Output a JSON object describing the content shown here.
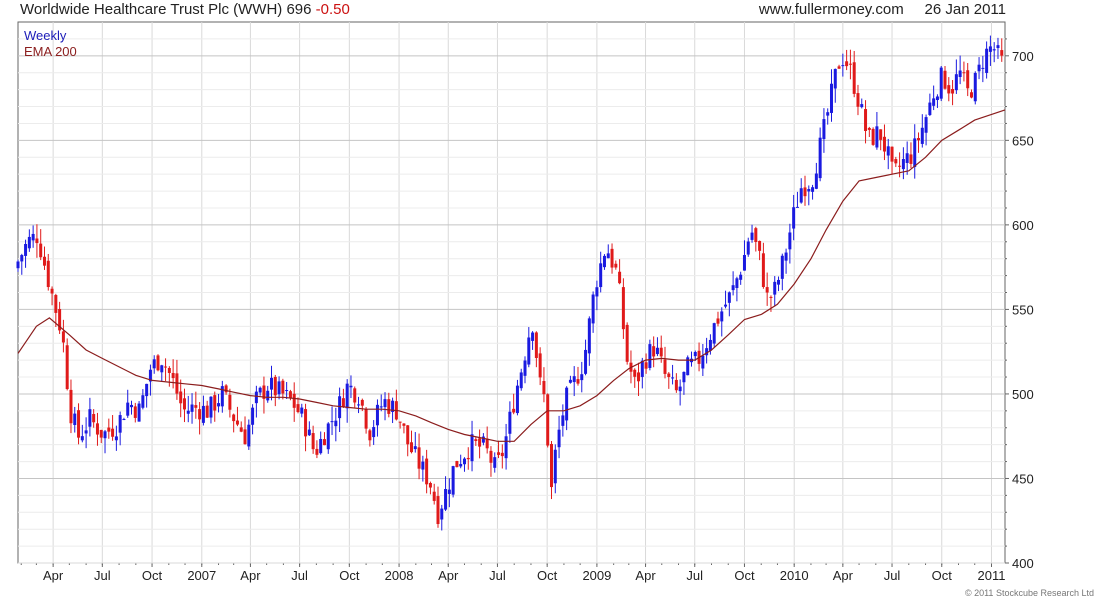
{
  "header": {
    "security": "Worldwide Healthcare Trust Plc (WWH)",
    "last_price": "696",
    "change": "-0.50",
    "site": "www.fullermoney.com",
    "date": "26 Jan 2011"
  },
  "legend": {
    "weekly": "Weekly",
    "ema": "EMA 200"
  },
  "copyright": "© 2011 Stockcube Research Ltd",
  "colors": {
    "up": "#1a1ae0",
    "down": "#e01a1a",
    "ema": "#8b1d1d",
    "grid": "#d9d9d9",
    "axis": "#666666",
    "background": "#ffffff"
  },
  "chart_data": {
    "type": "candlestick",
    "frequency": "weekly",
    "ylim": [
      400,
      720
    ],
    "yticks": [
      400,
      450,
      500,
      550,
      600,
      650,
      700
    ],
    "xlim": [
      "2006-01-26",
      "2011-01-26"
    ],
    "x_ticks": [
      {
        "label": "Apr",
        "date": "2006-04-01"
      },
      {
        "label": "Jul",
        "date": "2006-07-01"
      },
      {
        "label": "Oct",
        "date": "2006-10-01"
      },
      {
        "label": "2007",
        "date": "2007-01-01"
      },
      {
        "label": "Apr",
        "date": "2007-04-01"
      },
      {
        "label": "Jul",
        "date": "2007-07-01"
      },
      {
        "label": "Oct",
        "date": "2007-10-01"
      },
      {
        "label": "2008",
        "date": "2008-01-01"
      },
      {
        "label": "Apr",
        "date": "2008-04-01"
      },
      {
        "label": "Jul",
        "date": "2008-07-01"
      },
      {
        "label": "Oct",
        "date": "2008-10-01"
      },
      {
        "label": "2009",
        "date": "2009-01-01"
      },
      {
        "label": "Apr",
        "date": "2009-04-01"
      },
      {
        "label": "Jul",
        "date": "2009-07-01"
      },
      {
        "label": "Oct",
        "date": "2009-10-01"
      },
      {
        "label": "2010",
        "date": "2010-01-01"
      },
      {
        "label": "Apr",
        "date": "2010-04-01"
      },
      {
        "label": "Jul",
        "date": "2010-07-01"
      },
      {
        "label": "Oct",
        "date": "2010-10-01"
      },
      {
        "label": "2011",
        "date": "2011-01-01"
      }
    ],
    "grid": true,
    "legend_position": "top-left",
    "price_path": [
      [
        "2006-01-26",
        574
      ],
      [
        "2006-02-20",
        590
      ],
      [
        "2006-03-10",
        594
      ],
      [
        "2006-04-05",
        560
      ],
      [
        "2006-04-25",
        535
      ],
      [
        "2006-05-10",
        490
      ],
      [
        "2006-05-25",
        475
      ],
      [
        "2006-06-15",
        485
      ],
      [
        "2006-07-10",
        476
      ],
      [
        "2006-08-05",
        482
      ],
      [
        "2006-08-25",
        495
      ],
      [
        "2006-09-15",
        490
      ],
      [
        "2006-10-05",
        515
      ],
      [
        "2006-10-25",
        522
      ],
      [
        "2006-11-15",
        508
      ],
      [
        "2006-12-05",
        490
      ],
      [
        "2006-12-25",
        492
      ],
      [
        "2007-01-20",
        490
      ],
      [
        "2007-02-15",
        500
      ],
      [
        "2007-03-10",
        485
      ],
      [
        "2007-03-30",
        475
      ],
      [
        "2007-04-20",
        497
      ],
      [
        "2007-05-10",
        505
      ],
      [
        "2007-06-05",
        500
      ],
      [
        "2007-06-25",
        495
      ],
      [
        "2007-07-15",
        485
      ],
      [
        "2007-08-05",
        465
      ],
      [
        "2007-08-25",
        478
      ],
      [
        "2007-09-15",
        490
      ],
      [
        "2007-10-05",
        505
      ],
      [
        "2007-10-25",
        500
      ],
      [
        "2007-11-15",
        478
      ],
      [
        "2007-12-10",
        496
      ],
      [
        "2008-01-05",
        490
      ],
      [
        "2008-01-25",
        470
      ],
      [
        "2008-02-15",
        458
      ],
      [
        "2008-03-05",
        448
      ],
      [
        "2008-03-20",
        430
      ],
      [
        "2008-04-01",
        440
      ],
      [
        "2008-04-20",
        458
      ],
      [
        "2008-05-20",
        470
      ],
      [
        "2008-06-15",
        468
      ],
      [
        "2008-07-05",
        455
      ],
      [
        "2008-07-20",
        468
      ],
      [
        "2008-08-10",
        500
      ],
      [
        "2008-08-25",
        520
      ],
      [
        "2008-09-10",
        545
      ],
      [
        "2008-09-25",
        505
      ],
      [
        "2008-10-05",
        495
      ],
      [
        "2008-10-15",
        440
      ],
      [
        "2008-10-25",
        470
      ],
      [
        "2008-11-10",
        495
      ],
      [
        "2008-11-25",
        505
      ],
      [
        "2008-12-15",
        520
      ],
      [
        "2009-01-05",
        565
      ],
      [
        "2009-01-25",
        588
      ],
      [
        "2009-02-15",
        570
      ],
      [
        "2009-03-05",
        520
      ],
      [
        "2009-03-20",
        505
      ],
      [
        "2009-04-05",
        520
      ],
      [
        "2009-04-25",
        528
      ],
      [
        "2009-05-15",
        510
      ],
      [
        "2009-06-05",
        500
      ],
      [
        "2009-06-25",
        515
      ],
      [
        "2009-07-15",
        520
      ],
      [
        "2009-08-05",
        535
      ],
      [
        "2009-08-25",
        548
      ],
      [
        "2009-09-15",
        560
      ],
      [
        "2009-10-05",
        578
      ],
      [
        "2009-10-20",
        598
      ],
      [
        "2009-11-05",
        580
      ],
      [
        "2009-11-20",
        555
      ],
      [
        "2009-12-05",
        562
      ],
      [
        "2009-12-20",
        580
      ],
      [
        "2010-01-05",
        603
      ],
      [
        "2010-01-20",
        622
      ],
      [
        "2010-02-10",
        627
      ],
      [
        "2010-02-28",
        650
      ],
      [
        "2010-03-15",
        672
      ],
      [
        "2010-03-30",
        695
      ],
      [
        "2010-04-10",
        700
      ],
      [
        "2010-04-25",
        688
      ],
      [
        "2010-05-10",
        670
      ],
      [
        "2010-05-25",
        650
      ],
      [
        "2010-06-15",
        655
      ],
      [
        "2010-07-01",
        640
      ],
      [
        "2010-07-10",
        628
      ],
      [
        "2010-07-25",
        636
      ],
      [
        "2010-08-15",
        642
      ],
      [
        "2010-09-05",
        660
      ],
      [
        "2010-09-25",
        680
      ],
      [
        "2010-10-10",
        688
      ],
      [
        "2010-10-25",
        680
      ],
      [
        "2010-11-10",
        690
      ],
      [
        "2010-11-25",
        678
      ],
      [
        "2010-12-10",
        685
      ],
      [
        "2010-12-25",
        700
      ],
      [
        "2011-01-10",
        706
      ],
      [
        "2011-01-26",
        696
      ]
    ],
    "ema_200": [
      [
        "2006-01-26",
        524
      ],
      [
        "2006-03-01",
        540
      ],
      [
        "2006-03-25",
        545
      ],
      [
        "2006-05-01",
        535
      ],
      [
        "2006-06-01",
        526
      ],
      [
        "2006-07-01",
        521
      ],
      [
        "2006-08-01",
        516
      ],
      [
        "2006-09-01",
        511
      ],
      [
        "2006-10-01",
        508
      ],
      [
        "2006-11-01",
        507
      ],
      [
        "2006-12-01",
        506
      ],
      [
        "2007-01-01",
        505
      ],
      [
        "2007-02-01",
        503
      ],
      [
        "2007-03-01",
        501
      ],
      [
        "2007-04-01",
        499
      ],
      [
        "2007-05-01",
        498
      ],
      [
        "2007-06-01",
        498
      ],
      [
        "2007-07-01",
        497
      ],
      [
        "2007-08-01",
        495
      ],
      [
        "2007-09-01",
        493
      ],
      [
        "2007-10-01",
        492
      ],
      [
        "2007-11-01",
        491
      ],
      [
        "2007-12-01",
        491
      ],
      [
        "2008-01-01",
        490
      ],
      [
        "2008-02-01",
        487
      ],
      [
        "2008-03-01",
        483
      ],
      [
        "2008-04-01",
        479
      ],
      [
        "2008-05-01",
        476
      ],
      [
        "2008-06-01",
        474
      ],
      [
        "2008-07-01",
        472
      ],
      [
        "2008-08-01",
        472
      ],
      [
        "2008-09-01",
        482
      ],
      [
        "2008-10-01",
        490
      ],
      [
        "2008-11-01",
        490
      ],
      [
        "2008-12-01",
        493
      ],
      [
        "2009-01-01",
        499
      ],
      [
        "2009-02-01",
        508
      ],
      [
        "2009-03-01",
        515
      ],
      [
        "2009-04-01",
        520
      ],
      [
        "2009-05-01",
        521
      ],
      [
        "2009-06-01",
        520
      ],
      [
        "2009-07-01",
        520
      ],
      [
        "2009-08-01",
        526
      ],
      [
        "2009-09-01",
        535
      ],
      [
        "2009-10-01",
        544
      ],
      [
        "2009-11-01",
        547
      ],
      [
        "2009-12-01",
        553
      ],
      [
        "2010-01-01",
        565
      ],
      [
        "2010-02-01",
        580
      ],
      [
        "2010-03-01",
        597
      ],
      [
        "2010-04-01",
        614
      ],
      [
        "2010-05-01",
        626
      ],
      [
        "2010-06-01",
        628
      ],
      [
        "2010-07-01",
        630
      ],
      [
        "2010-08-01",
        632
      ],
      [
        "2010-09-01",
        640
      ],
      [
        "2010-10-01",
        650
      ],
      [
        "2010-11-01",
        656
      ],
      [
        "2010-12-01",
        662
      ],
      [
        "2011-01-26",
        668
      ]
    ]
  }
}
